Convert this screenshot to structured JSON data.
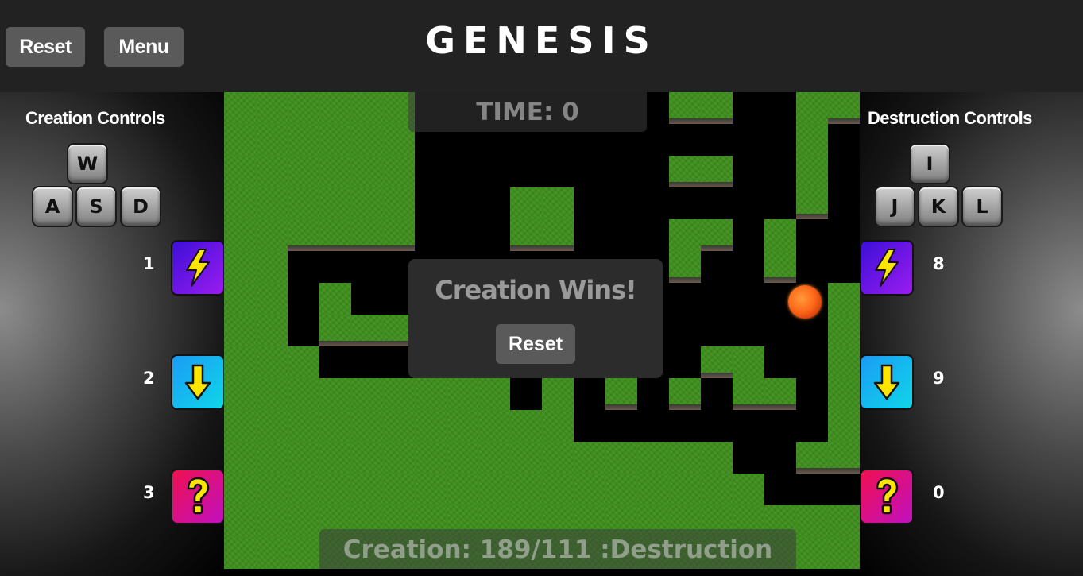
{
  "header": {
    "title": "GENESIS",
    "reset_label": "Reset",
    "menu_label": "Menu"
  },
  "creation": {
    "title": "Creation Controls",
    "keys": [
      "W",
      "A",
      "S",
      "D"
    ],
    "powers": [
      {
        "key": "1",
        "icon": "lightning-icon"
      },
      {
        "key": "2",
        "icon": "down-arrow-icon"
      },
      {
        "key": "3",
        "icon": "question-mark-icon"
      }
    ]
  },
  "destruction": {
    "title": "Destruction Controls",
    "keys": [
      "I",
      "J",
      "K",
      "L"
    ],
    "powers": [
      {
        "key": "8",
        "icon": "lightning-icon"
      },
      {
        "key": "9",
        "icon": "down-arrow-icon"
      },
      {
        "key": "0",
        "icon": "question-mark-icon"
      }
    ]
  },
  "game": {
    "time_text": "TIME: 0",
    "score_text": "Creation: 189/111 :Destruction",
    "grid": [
      "######00000000##..##",
      "######0000000000..#.",
      "######00000000##0.#.",
      "######000##000000.#.",
      "######000##000##0#..",
      "##....0..00000#00#..",
      "##0#00000000000000.#",
      "##0####00000000000.#",
      "###00000###00..##0.#",
      "#########0#0#0#0##.#",
      "###########0000000.#",
      "################0.##",
      "#################000",
      "####################",
      "####################"
    ]
  },
  "dialog": {
    "message": "Creation Wins!",
    "reset_label": "Reset"
  },
  "colors": {
    "grass": "#3e8e1d",
    "void": "#000000",
    "lightning_bg": "#6a18e8",
    "down_bg": "#14b8ee",
    "question_bg": "#e01080",
    "icon_yellow": "#ffe600"
  }
}
